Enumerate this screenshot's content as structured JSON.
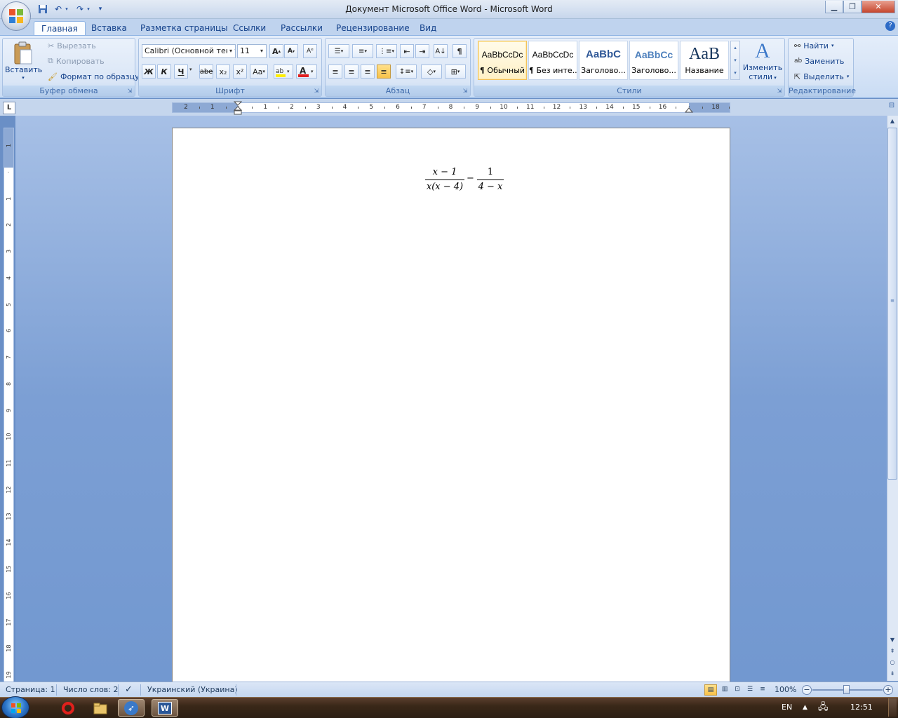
{
  "window": {
    "title": "Документ Microsoft Office Word - Microsoft Word"
  },
  "tabs": [
    {
      "label": "Главная",
      "active": true
    },
    {
      "label": "Вставка"
    },
    {
      "label": "Разметка страницы"
    },
    {
      "label": "Ссылки"
    },
    {
      "label": "Рассылки"
    },
    {
      "label": "Рецензирование"
    },
    {
      "label": "Вид"
    }
  ],
  "ribbon": {
    "clipboard": {
      "label": "Буфер обмена",
      "paste": "Вставить",
      "cut": "Вырезать",
      "copy": "Копировать",
      "format_painter": "Формат по образцу"
    },
    "font": {
      "label": "Шрифт",
      "font_name": "Calibri (Основной текст)",
      "font_size": "11",
      "bold": "Ж",
      "italic": "К",
      "underline": "Ч",
      "strikethrough": "abe",
      "subscript": "x₂",
      "superscript": "x²",
      "change_case": "Aa",
      "grow": "A",
      "shrink": "A",
      "font_color": "A"
    },
    "paragraph": {
      "label": "Абзац",
      "pilcrow": "¶"
    },
    "styles": {
      "label": "Стили",
      "items": [
        {
          "sample": "AaBbCcDc",
          "name": "¶ Обычный",
          "selected": true
        },
        {
          "sample": "AaBbCcDc",
          "name": "¶ Без инте..."
        },
        {
          "sample": "AaBbC",
          "name": "Заголово..."
        },
        {
          "sample": "AaBbCc",
          "name": "Заголово..."
        },
        {
          "sample": "AaB",
          "name": "Название"
        }
      ],
      "change_styles": "Изменить",
      "change_styles_2": "стили"
    },
    "editing": {
      "label": "Редактирование",
      "find": "Найти",
      "replace": "Заменить",
      "select": "Выделить"
    }
  },
  "ruler": {
    "numbers": [
      "2",
      "1",
      "",
      "1",
      "2",
      "3",
      "4",
      "5",
      "6",
      "7",
      "8",
      "9",
      "10",
      "11",
      "12",
      "13",
      "14",
      "15",
      "16",
      "",
      "18"
    ],
    "vnumbers": [
      "1",
      "",
      "1",
      "2",
      "3",
      "4",
      "5",
      "6",
      "7",
      "8",
      "9",
      "10",
      "11",
      "12",
      "13",
      "14",
      "15",
      "16",
      "17",
      "18",
      "19"
    ]
  },
  "document": {
    "equation": {
      "frac1_num": "x − 1",
      "frac1_den": "x(x − 4)",
      "operator": "−",
      "frac2_num": "1",
      "frac2_den": "4 − x"
    }
  },
  "statusbar": {
    "page": "Страница: 1",
    "words": "Число слов: 2",
    "language": "Украинский (Украина)",
    "zoom": "100%"
  },
  "taskbar": {
    "lang": "EN",
    "time": "12:51"
  },
  "colors": {
    "accent": "#15428b",
    "ribbon_bg": "#dbe7f8",
    "doc_bg": "#7c9fd4"
  }
}
